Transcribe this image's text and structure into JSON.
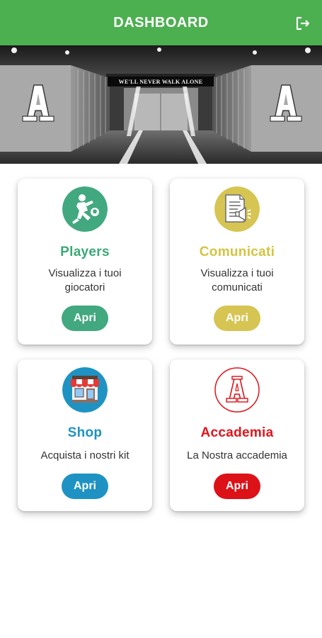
{
  "header": {
    "title": "DASHBOARD",
    "logout_icon": "logout-icon",
    "background": "#4caf50"
  },
  "banner": {
    "slogan": "WE'LL NEVER WALK ALONE",
    "logo_letter": "A"
  },
  "cards": [
    {
      "title": "Players",
      "description": "Visualizza i tuoi giocatori",
      "button": "Apri",
      "icon": "player-kicking-ball-icon",
      "color": "#42a87f"
    },
    {
      "title": "Comunicati",
      "description": "Visualizza i tuoi comunicati",
      "button": "Apri",
      "icon": "announcement-document-icon",
      "color": "#d6c553"
    },
    {
      "title": "Shop",
      "description": "Acquista i nostri kit",
      "button": "Apri",
      "icon": "shop-storefront-icon",
      "color": "#1e93c3"
    },
    {
      "title": "Accademia",
      "description": "La Nostra accademia",
      "button": "Apri",
      "icon": "academy-logo-icon",
      "color": "#dd1118"
    }
  ]
}
